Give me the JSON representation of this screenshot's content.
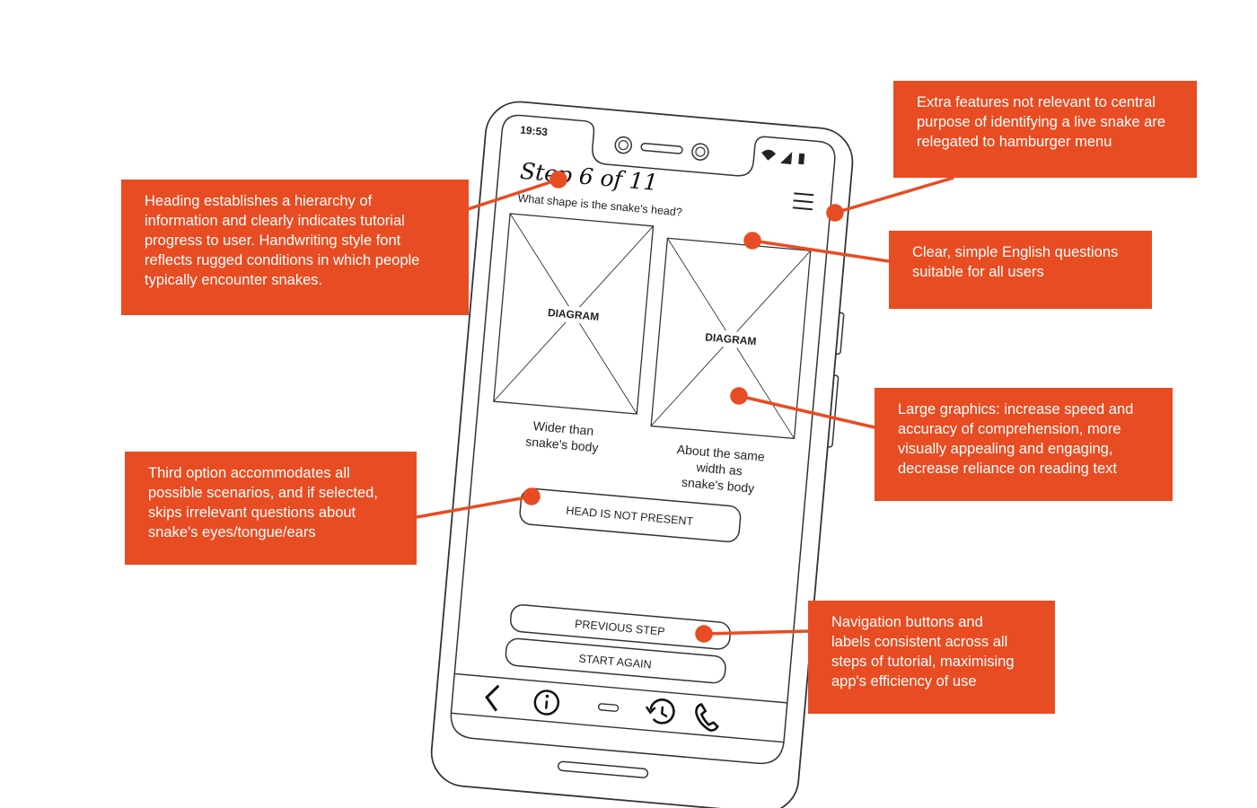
{
  "status_bar": {
    "time": "19:53"
  },
  "screen": {
    "heading": "Step 6 of 11",
    "question": "What shape is the snake's head?",
    "options": [
      {
        "diagram_label": "DIAGRAM",
        "caption_lines": [
          "Wider than",
          "snake's body"
        ]
      },
      {
        "diagram_label": "DIAGRAM",
        "caption_lines": [
          "About the same",
          "width as",
          "snake's body"
        ]
      }
    ],
    "third_option": "HEAD IS NOT PRESENT",
    "nav": {
      "previous": "PREVIOUS STEP",
      "start_again": "START AGAIN"
    }
  },
  "bottom_bar": {
    "icons": [
      "back-icon",
      "info-icon",
      "home-pill-icon",
      "history-icon",
      "phone-icon"
    ]
  },
  "annotations": {
    "heading_note": [
      "Heading establishes a hierarchy of",
      "information and clearly indicates tutorial",
      "progress to user. Handwriting style font",
      "reflects rugged conditions in which people",
      "typically encounter snakes."
    ],
    "menu_note": [
      "Extra features not relevant to central",
      "purpose of identifying a live snake are",
      "relegated to hamburger menu"
    ],
    "question_note": [
      "Clear, simple English questions",
      "suitable for all users"
    ],
    "graphics_note": [
      "Large graphics: increase speed and",
      "accuracy of comprehension, more",
      "visually appealing and engaging,",
      "decrease reliance on reading text"
    ],
    "third_option_note": [
      "Third option accommodates all",
      "possible scenarios, and if selected,",
      "skips irrelevant questions about",
      "snake's eyes/tongue/ears"
    ],
    "nav_note": [
      "Navigation buttons and",
      "labels consistent across all",
      "steps of tutorial, maximising",
      "app's efficiency of use"
    ]
  },
  "colors": {
    "annotation": "#e84c22",
    "outline": "#333333"
  }
}
